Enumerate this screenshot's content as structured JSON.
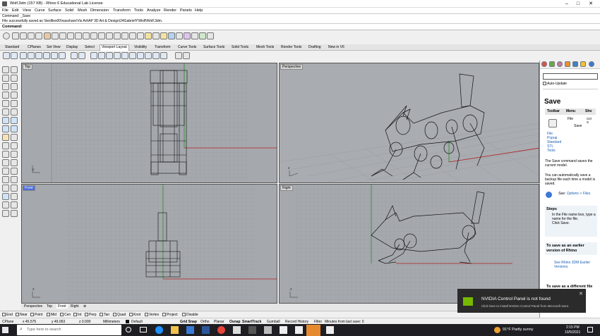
{
  "window": {
    "title": "Wolf.3dm (157 KB) - Rhino 6 Educational Lab License",
    "controls": [
      "–",
      "□",
      "✕"
    ]
  },
  "menu": [
    "File",
    "Edit",
    "View",
    "Curve",
    "Surface",
    "Solid",
    "Mesh",
    "Dimension",
    "Transform",
    "Tools",
    "Analyze",
    "Render",
    "Panels",
    "Help"
  ],
  "command": {
    "history": [
      "Command: _Save",
      "File successfully saved as \\\\tesfiles00\\nasshare\\Vis Art\\AP 3D Art & Design\\24GabrielY\\Wolf\\Wolf.3dm."
    ],
    "prompt": "Command:"
  },
  "toolbar_tabs": [
    "Standard",
    "CPlanes",
    "Set View",
    "Display",
    "Select",
    "Viewport Layout",
    "Visibility",
    "Transform",
    "Curve Tools",
    "Surface Tools",
    "Solid Tools",
    "Mesh Tools",
    "Render Tools",
    "Drafting",
    "New in V6"
  ],
  "active_tab": "Viewport Layout",
  "viewports": {
    "top": "Top",
    "perspective": "Perspective",
    "front": "Front",
    "right": "Right"
  },
  "viewport_tabs": [
    "Perspective",
    "Top",
    "Front",
    "Right",
    "⊕"
  ],
  "osnaps": [
    {
      "label": "End",
      "on": true
    },
    {
      "label": "Near",
      "on": false
    },
    {
      "label": "Point",
      "on": true
    },
    {
      "label": "Mid",
      "on": true
    },
    {
      "label": "Cen",
      "on": false
    },
    {
      "label": "Int",
      "on": false
    },
    {
      "label": "Perp",
      "on": false
    },
    {
      "label": "Tan",
      "on": false
    },
    {
      "label": "Quad",
      "on": false
    },
    {
      "label": "Knot",
      "on": false
    },
    {
      "label": "Vertex",
      "on": false
    },
    {
      "label": "Project",
      "on": false
    },
    {
      "label": "Disable",
      "on": false
    }
  ],
  "status": {
    "cplane": "CPlane",
    "x": "x 45.575",
    "y": "y 49.063",
    "z": "z 0.000",
    "units": "Millimeters",
    "layer": "Default",
    "toggles": [
      "Grid Snap",
      "Ortho",
      "Planar",
      "Osnap",
      "SmartTrack",
      "Gumball",
      "Record History",
      "Filter"
    ],
    "bold_toggles": [
      "Grid Snap",
      "Osnap",
      "SmartTrack"
    ],
    "message": "Minutes from last save: 0"
  },
  "panel": {
    "auto_update": "Auto-Update",
    "heading": "Save",
    "table_headers": [
      "Toolbar",
      "Menu",
      "Sho"
    ],
    "menu_items": [
      "File",
      "Save"
    ],
    "shortcut": "Ctrl S",
    "toolbar_links": [
      "File",
      "Popup",
      "Standard",
      "STL",
      "Tools"
    ],
    "desc1": "The Save command saves the current model.",
    "desc2": "You can automatically save a backup file each time a model is saved.",
    "see_label": "See:",
    "see_link": "Options > Files.",
    "steps_title": "Steps",
    "steps": [
      "In the File name box, type a name for the file.",
      "Click Save."
    ],
    "earlier_title": "To save as an earlier version of Rhino",
    "earlier_items": [
      "See Rhino 3DM Earlier Versions."
    ],
    "diff_title": "To save as a different file format"
  },
  "notification": {
    "title": "NVIDIA Control Panel is not found",
    "body": "Click here to install NVIDIA Control Panel from Microsoft store."
  },
  "taskbar": {
    "search": "Type here to search",
    "weather": "91°F  Partly sunny",
    "time": "2:15 PM",
    "date": "10/5/2021"
  },
  "colors": {
    "viewport_bg": "#a5a8ad",
    "grid": "#9b9ea3",
    "x_axis": "#b02020",
    "y_axis": "#2a8a2a",
    "active_label": "#4b6bd6",
    "taskbar": "#1f1f23"
  }
}
